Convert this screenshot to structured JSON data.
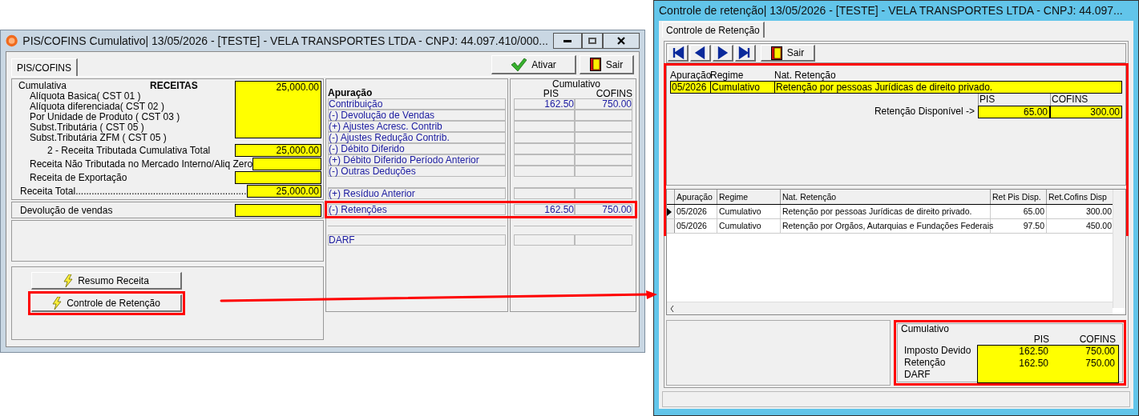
{
  "left_window": {
    "title": "PIS/COFINS Cumulativo|  13/05/2026 - [TESTE] - VELA TRANSPORTES LTDA - CNPJ: 44.097.410/000...",
    "tab": {
      "label": "PIS/COFINS",
      "selected": true
    },
    "actions": [
      {
        "kind": "check",
        "label": "Ativar"
      },
      {
        "kind": "exit",
        "label": "Sair"
      }
    ],
    "receitas": {
      "group_label": "Cumulativa",
      "heading": "RECEITAS",
      "basic_labels": [
        "Alíquota Basica( CST 01 )",
        "Alíquota diferenciada( CST 02 )",
        "Por Unidade de Produto ( CST 03 )",
        "Subst.Tributária ( CST 05 )",
        "Subst.Tributária ZFM ( CST 05 )"
      ],
      "basic_value": "25,000.00",
      "rows": [
        {
          "kind": "subtotal",
          "label": "2 - Receita Tributada Cumulativa Total",
          "value": "25,000.00"
        },
        {
          "kind": "line",
          "label": "Receita Não Tributada no Mercado Interno/Aliq Zero"
        },
        {
          "kind": "line",
          "label": "Receita de Exportação"
        },
        {
          "kind": "total",
          "label": "Receita Total................................................................",
          "value": "25,000.00"
        }
      ]
    },
    "devolucao": {
      "label": "Devolução de vendas"
    },
    "buttons": [
      {
        "label": "Resumo Receita",
        "highlighted": false
      },
      {
        "label": "Controle de Retenção",
        "highlighted": true
      }
    ],
    "apuracao": {
      "heading": "Apuração",
      "column_group": "Cumulativo",
      "columns": [
        "PIS",
        "COFINS"
      ],
      "rows": [
        {
          "kind": "line",
          "label": "Contribuição",
          "pis": "162.50",
          "cofins": "750.00"
        },
        {
          "kind": "line",
          "label": "(-) Devolução de Vendas"
        },
        {
          "kind": "line",
          "label": "(+) Ajustes Acresc. Contrib"
        },
        {
          "kind": "line",
          "label": "(-) Ajustes Redução Contrib."
        },
        {
          "kind": "line",
          "label": "(-) Débito Diferido"
        },
        {
          "kind": "line",
          "label": "(+) Débito Diferido Período  Anterior"
        },
        {
          "kind": "line",
          "label": "(-) Outras Deduções"
        },
        {
          "kind": "blank"
        },
        {
          "kind": "line",
          "label": "(+) Resíduo Anterior"
        },
        {
          "kind": "highlighted",
          "label": "(-) Retenções",
          "pis": "162.50",
          "cofins": "750.00"
        },
        {
          "kind": "blank"
        },
        {
          "kind": "darf",
          "label": "DARF"
        }
      ]
    }
  },
  "right_window": {
    "title": "Controle de retenção|  13/05/2026 - [TESTE] - VELA TRANSPORTES LTDA - CNPJ: 44.097...",
    "tab": {
      "label": "Controle de Retenção",
      "selected": true
    },
    "toolbar": [
      {
        "kind": "first"
      },
      {
        "kind": "prev"
      },
      {
        "kind": "next"
      },
      {
        "kind": "last"
      },
      {
        "kind": "exit",
        "label": "Sair"
      }
    ],
    "record": {
      "columns": [
        "Apuração",
        "Regime",
        "Nat. Retenção"
      ],
      "values": [
        "05/2026",
        "Cumulativo",
        "Retenção por pessoas Jurídicas de direito privado."
      ],
      "available_label": "Retenção Disponível ->",
      "available_columns": [
        "PIS",
        "COFINS"
      ],
      "available_values": [
        "65.00",
        "300.00"
      ]
    },
    "grid": {
      "columns": [
        "Apuração",
        "Regime",
        "Nat. Retenção",
        "Ret Pis Disp.",
        "Ret.Cofins Disp"
      ],
      "rows": [
        {
          "selected": true,
          "cells": [
            "05/2026",
            "Cumulativo",
            "Retenção por pessoas Jurídicas de direito privado.",
            "65.00",
            "300.00"
          ]
        },
        {
          "selected": false,
          "cells": [
            "05/2026",
            "Cumulativo",
            "Retenção por Orgãos, Autarquias e Fundações Federais",
            "97.50",
            "450.00"
          ]
        }
      ]
    },
    "summary": {
      "group_label": "Cumulativo",
      "columns": [
        "PIS",
        "COFINS"
      ],
      "rows": [
        {
          "label": "Imposto Devido",
          "pis": "162.50",
          "cofins": "750.00"
        },
        {
          "label": "Retenção",
          "pis": "162.50",
          "cofins": "750.00"
        },
        {
          "label": "DARF"
        }
      ]
    }
  }
}
